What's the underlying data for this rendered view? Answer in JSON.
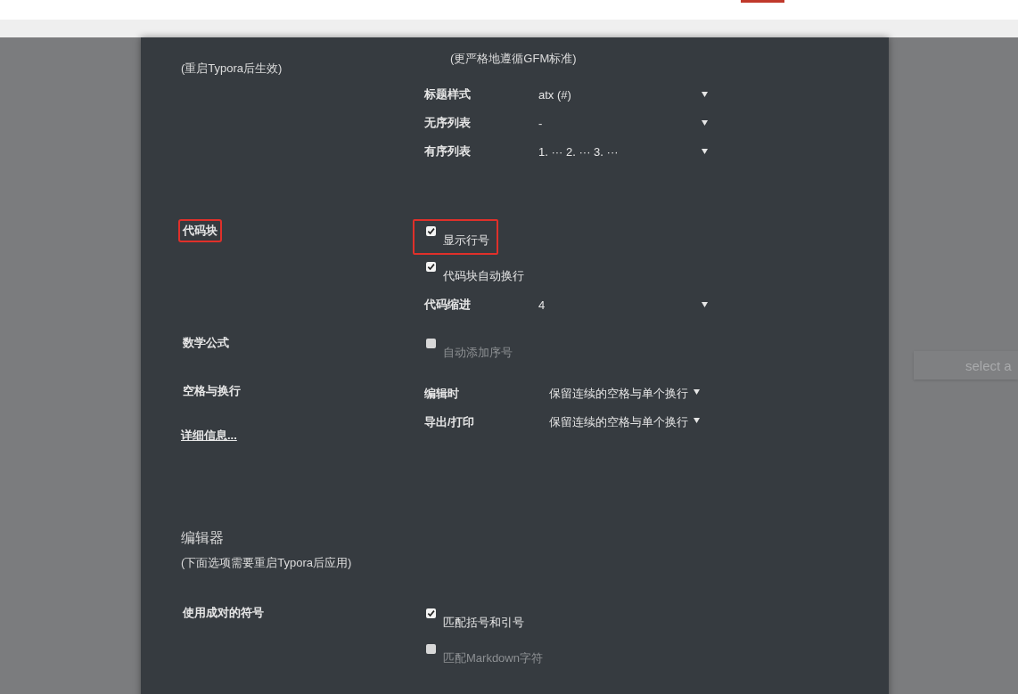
{
  "background": {
    "select_button": {
      "label": "select a"
    }
  },
  "dialog": {
    "restart_note": "(重启Typora后生效)",
    "gfm_note": "(更严格地遵循GFM标准)",
    "selects": [
      {
        "label": "标题样式",
        "value": "atx (#)"
      },
      {
        "label": "无序列表",
        "value": "-"
      },
      {
        "label": "有序列表",
        "value": "1. ··· 2. ··· 3. ···"
      }
    ],
    "sections": [
      {
        "title": "代码块",
        "highlighted": true,
        "options": [
          {
            "kind": "checkbox",
            "label": "显示行号",
            "checked": true,
            "highlighted": true
          },
          {
            "kind": "checkbox",
            "label": "代码块自动换行",
            "checked": true,
            "highlighted": false
          },
          {
            "kind": "select",
            "label": "代码缩进",
            "value": "4"
          }
        ]
      },
      {
        "title": "数学公式",
        "highlighted": false,
        "options": [
          {
            "kind": "checkbox",
            "label": "自动添加序号",
            "checked": false,
            "highlighted": false
          }
        ]
      },
      {
        "title": "空格与换行",
        "highlighted": false,
        "link": "详细信息...",
        "options": [
          {
            "kind": "select",
            "label": "编辑时",
            "value": "保留连续的空格与单个换行"
          },
          {
            "kind": "select",
            "label": "导出/打印",
            "value": "保留连续的空格与单个换行"
          }
        ]
      }
    ],
    "editor": {
      "heading": "编辑器",
      "note": "(下面选项需要重启Typora后应用)",
      "sections": [
        {
          "title": "使用成对的符号",
          "highlighted": false,
          "options": [
            {
              "kind": "checkbox",
              "label": "匹配括号和引号",
              "checked": true,
              "highlighted": false
            },
            {
              "kind": "checkbox",
              "label": "匹配Markdown字符",
              "checked": false,
              "highlighted": false
            }
          ]
        }
      ]
    }
  }
}
